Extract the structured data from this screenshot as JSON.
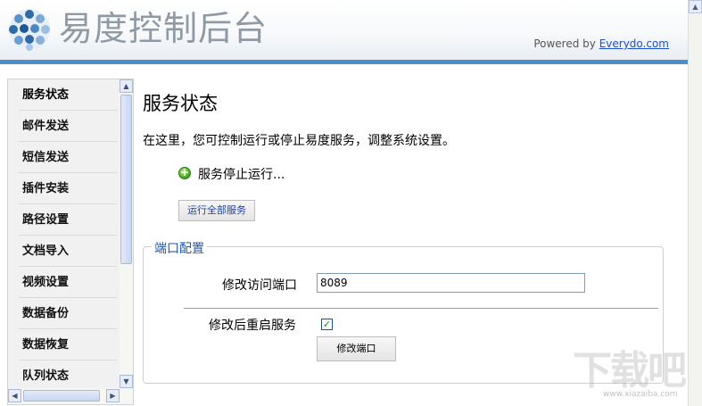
{
  "header": {
    "title": "易度控制后台",
    "powered_prefix": "Powered by ",
    "powered_link": "Everydo.com"
  },
  "sidebar": {
    "items": [
      {
        "label": "服务状态"
      },
      {
        "label": "邮件发送"
      },
      {
        "label": "短信发送"
      },
      {
        "label": "插件安装"
      },
      {
        "label": "路径设置"
      },
      {
        "label": "文档导入"
      },
      {
        "label": "视频设置"
      },
      {
        "label": "数据备份"
      },
      {
        "label": "数据恢复"
      },
      {
        "label": "队列状态"
      }
    ]
  },
  "main": {
    "title": "服务状态",
    "description": "在这里，您可控制运行或停止易度服务，调整系统设置。",
    "status_text": "服务停止运行...",
    "run_all_button": "运行全部服务",
    "port_config": {
      "legend": "端口配置",
      "port_label": "修改访问端口",
      "port_value": "8089",
      "restart_label": "修改后重启服务",
      "restart_checked": true,
      "change_port_button": "修改端口"
    }
  },
  "watermark": {
    "text": "下载吧",
    "url": "www.xiazaiba.com"
  },
  "colors": {
    "header_bar": "#4b8fc4",
    "link": "#1f50c8",
    "legend": "#1f56a8",
    "status_green": "#3fa01b"
  },
  "icons": {
    "logo": "globe-dots-icon",
    "status": "green-plus-icon"
  }
}
